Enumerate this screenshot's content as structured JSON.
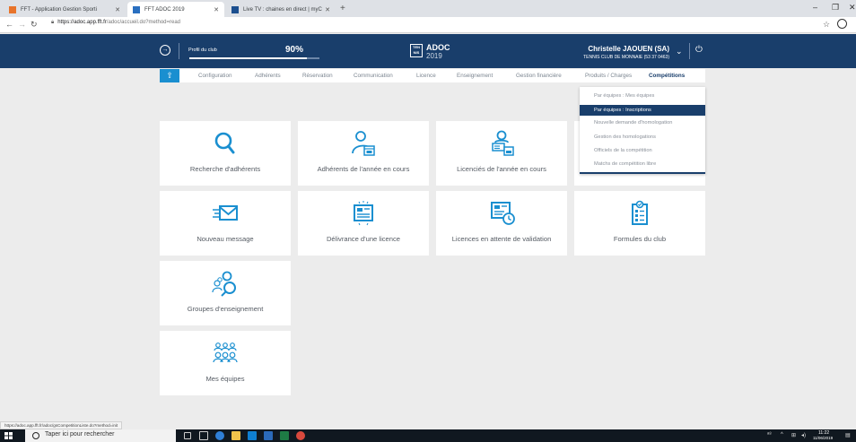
{
  "browser": {
    "tabs": [
      {
        "title": "FFT - Application Gestion Sporti",
        "active": false
      },
      {
        "title": "FFT ADOC 2019",
        "active": true
      },
      {
        "title": "Live TV : chaines en direct | myC",
        "active": false
      }
    ],
    "url_domain": "https://adoc.app.fft.fr",
    "url_path": "/adoc/accueil.do?method=read",
    "status_url": "https://adoc.app.fft.fr/adoc/gsCompetitionListe.do?method=init"
  },
  "header": {
    "club_label": "Profil du club",
    "club_percent": "90%",
    "club_progress": 0.9,
    "logo_text": "TEN NIS",
    "app_title": "ADOC",
    "app_year": "2019",
    "user_name": "Christelle JAOUEN (SA)",
    "user_club": "TENNIS CLUB DE MONNAIE (53 37 0463)"
  },
  "menu": {
    "items": [
      {
        "label": "Configuration"
      },
      {
        "label": "Adhérents"
      },
      {
        "label": "Réservation"
      },
      {
        "label": "Communication"
      },
      {
        "label": "Licence"
      },
      {
        "label": "Enseignement"
      },
      {
        "label": "Gestion financière"
      },
      {
        "label": "Produits / Charges"
      },
      {
        "label": "Compétitions"
      }
    ],
    "active": "Compétitions"
  },
  "dropdown": {
    "items": [
      {
        "label": "Par équipes : Mes équipes"
      },
      {
        "label": "Par équipes : Inscriptions"
      },
      {
        "label": "Nouvelle demande d'homologation"
      },
      {
        "label": "Gestion des homologations"
      },
      {
        "label": "Officiels de la compétition"
      },
      {
        "label": "Matchs de compétition libre"
      }
    ],
    "selected": "Par équipes : Inscriptions"
  },
  "tiles": [
    {
      "label": "Recherche d'adhérents",
      "icon": "search-icon"
    },
    {
      "label": "Adhérents de l'année en cours",
      "icon": "member-calendar-icon"
    },
    {
      "label": "Licenciés de l'année en cours",
      "icon": "licensee-calendar-icon"
    },
    {
      "label": "Nouveau message",
      "icon": "envelope-icon"
    },
    {
      "label": "Délivrance d'une licence",
      "icon": "license-card-icon"
    },
    {
      "label": "Licences en attente de validation",
      "icon": "license-pending-icon"
    },
    {
      "label": "Formules du club",
      "icon": "clipboard-icon"
    },
    {
      "label": "Groupes d'enseignement",
      "icon": "teaching-group-icon"
    },
    {
      "label": "Mes équipes",
      "icon": "teams-icon"
    }
  ],
  "taskbar": {
    "search_placeholder": "Taper ici pour rechercher",
    "time": "11:22",
    "date": "11/06/2019"
  },
  "colors": {
    "header": "#193e6b",
    "accent": "#1a8fd0",
    "background": "#ececec"
  }
}
